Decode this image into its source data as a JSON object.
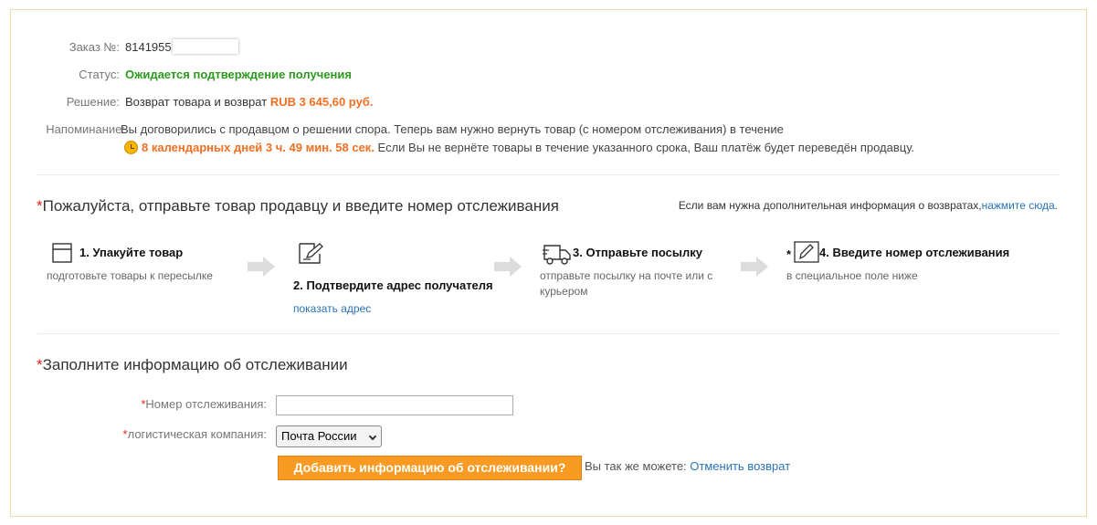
{
  "order": {
    "label": "Заказ №:",
    "number": "8141955"
  },
  "status": {
    "label": "Статус:",
    "value": "Ожидается подтверждение получения"
  },
  "decision": {
    "label": "Решение:",
    "text": "Возврат товара и возврат",
    "amount": "RUB 3 645,60 руб."
  },
  "reminder": {
    "label": "Напоминание:",
    "line1": "Вы договорились с продавцом о решении спора. Теперь вам нужно вернуть товар (с номером отслеживания) в течение",
    "countdown": "8 календарных дней 3 ч. 49 мин. 58 сек.",
    "line2_rest": "Если Вы не вернёте товары в течение указанного срока, Ваш платёж будет переведён продавцу."
  },
  "send_section": {
    "required_mark": "*",
    "title": "Пожалуйста, отправьте товар продавцу и введите номер отслеживания",
    "help_text": "Если вам нужна дополнительная информация о возвратах,",
    "help_link": "нажмите сюда."
  },
  "steps": [
    {
      "icon": "box-icon",
      "title": "1. Упакуйте товар",
      "desc": "подготовьте товары к пересылке"
    },
    {
      "icon": "edit-address-icon",
      "title": "2. Подтвердите адрес получателя",
      "link": "показать адрес"
    },
    {
      "icon": "truck-icon",
      "title": "3. Отправьте посылку",
      "desc": "отправьте посылку на почте или с курьером"
    },
    {
      "icon": "pencil-icon",
      "prefix": "*",
      "title": "4. Введите номер отслеживания",
      "desc": "в специальное поле ниже"
    }
  ],
  "tracking_section": {
    "required_mark": "*",
    "title": "Заполните информацию об отслеживании",
    "tracking_label": "Номер отслеживания:",
    "tracking_value": "",
    "carrier_label": "логистическая компания:",
    "carrier_selected": "Почта России",
    "submit_label": "Добавить информацию об отслеживании?",
    "alt_text": "Вы так же можете:",
    "cancel_link": "Отменить возврат"
  },
  "colors": {
    "status_green": "#2c9a1f",
    "accent_orange": "#f36f21",
    "button_orange": "#f99b22",
    "link_blue": "#2a73b8",
    "required_red": "#e2231a",
    "frame_border": "#f1d9a8"
  }
}
